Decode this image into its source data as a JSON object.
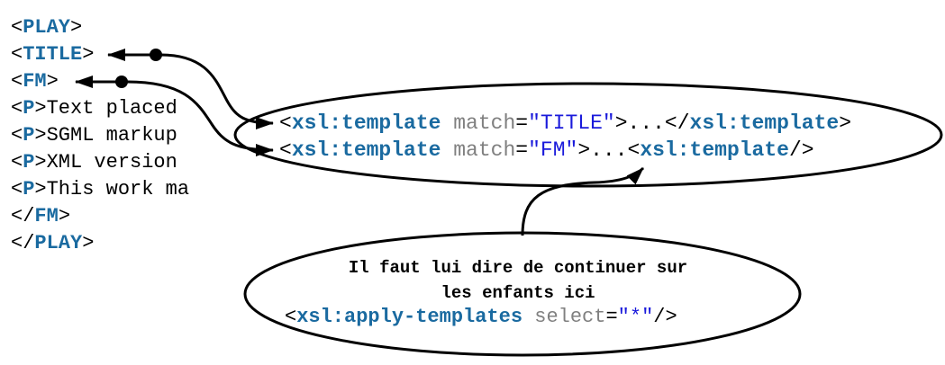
{
  "xml_listing": [
    {
      "open": "<",
      "tag": "PLAY",
      "close": ">",
      "text": ""
    },
    {
      "open": "<",
      "tag": "TITLE",
      "close": ">",
      "text": ""
    },
    {
      "open": "<",
      "tag": "FM",
      "close": ">",
      "text": ""
    },
    {
      "open": "<",
      "tag": "P",
      "close": ">",
      "text": "Text placed"
    },
    {
      "open": "<",
      "tag": "P",
      "close": ">",
      "text": "SGML markup"
    },
    {
      "open": "<",
      "tag": "P",
      "close": ">",
      "text": "XML version"
    },
    {
      "open": "<",
      "tag": "P",
      "close": ">",
      "text": "This work ma"
    },
    {
      "open": "</",
      "tag": "FM",
      "close": ">",
      "text": ""
    },
    {
      "open": "</",
      "tag": "PLAY",
      "close": ">",
      "text": ""
    }
  ],
  "templates": {
    "title_template": {
      "lt": "<",
      "element": "xsl:template",
      "attr": " match",
      "eq": "=",
      "value": "\"TITLE\"",
      "middle": ">...</",
      "end_element": "xsl:template",
      "gt": ">"
    },
    "fm_template": {
      "lt": "<",
      "element": "xsl:template",
      "attr": " match",
      "eq": "=",
      "value": "\"FM\"",
      "middle": ">...<",
      "end_element": "xsl:template",
      "gt": "/>"
    }
  },
  "note": {
    "line1": "Il faut lui dire de continuer sur",
    "line2": "les enfants ici",
    "code": {
      "lt": "<",
      "element": "xsl:apply-templates",
      "attr": " select",
      "eq": "=",
      "value": "\"*\"",
      "gt": "/>"
    }
  },
  "colors": {
    "tag": "#1a6aa0",
    "attribute": "#808080",
    "string": "#1a1adb",
    "stroke": "#000000"
  }
}
